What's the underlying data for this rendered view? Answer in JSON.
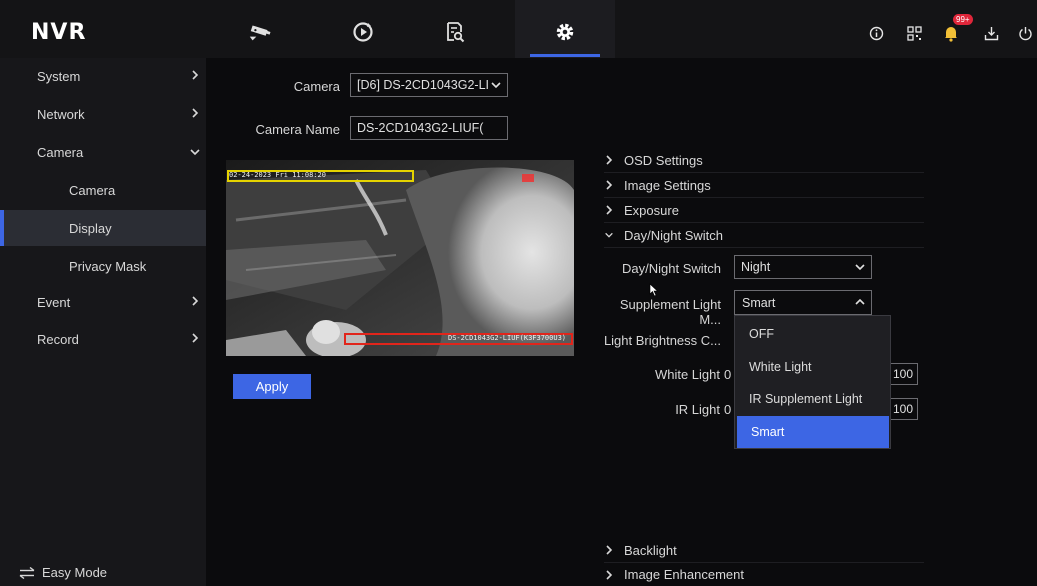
{
  "app": {
    "title": "NVR"
  },
  "topnav": {
    "items": [
      {
        "name": "live-view",
        "icon": "camera-icon"
      },
      {
        "name": "playback",
        "icon": "playback-icon"
      },
      {
        "name": "search",
        "icon": "search-file-icon"
      },
      {
        "name": "settings",
        "icon": "gear-icon",
        "active": true
      }
    ],
    "right_icons": [
      "info-icon",
      "qr-code-icon",
      "bell-icon",
      "download-icon",
      "power-icon"
    ],
    "notification_badge": "99+"
  },
  "sidebar": {
    "items": [
      {
        "label": "System",
        "expandable": true
      },
      {
        "label": "Network",
        "expandable": true
      },
      {
        "label": "Camera",
        "expanded": true
      },
      {
        "label": "Camera",
        "sub": true
      },
      {
        "label": "Display",
        "sub": true,
        "active": true
      },
      {
        "label": "Privacy Mask",
        "sub": true
      },
      {
        "label": "Event",
        "expandable": true
      },
      {
        "label": "Record",
        "expandable": true
      }
    ],
    "easy_mode": "Easy Mode"
  },
  "form": {
    "camera_label": "Camera",
    "camera_value": "[D6] DS-2CD1043G2-LI",
    "camera_name_label": "Camera Name",
    "camera_name_value": "DS-2CD1043G2-LIUF(",
    "apply": "Apply"
  },
  "preview": {
    "osd_datetime": "02-24-2023 Fri 11:08:20",
    "osd_camera_name": "DS-2CD1043G2-LIUF(K3F3700U3)"
  },
  "sections": {
    "osd": "OSD Settings",
    "image": "Image Settings",
    "exposure": "Exposure",
    "daynight": "Day/Night Switch",
    "backlight": "Backlight",
    "enhancement": "Image Enhancement"
  },
  "daynight": {
    "switch_label": "Day/Night Switch",
    "switch_value": "Night",
    "supplement_label": "Supplement Light M...",
    "supplement_value": "Smart",
    "brightness_label": "Light Brightness C...",
    "white_light_label": "White Light",
    "white_light_min": "0",
    "white_light_value": "100",
    "ir_light_label": "IR Light",
    "ir_light_min": "0",
    "ir_light_value": "100"
  },
  "supplement_options": [
    "OFF",
    "White Light",
    "IR Supplement Light",
    "Smart"
  ],
  "colors": {
    "accent": "#3d66e4",
    "badge": "#e0263a",
    "osd_box": "#e5d300",
    "mask_box": "#e1251b"
  }
}
